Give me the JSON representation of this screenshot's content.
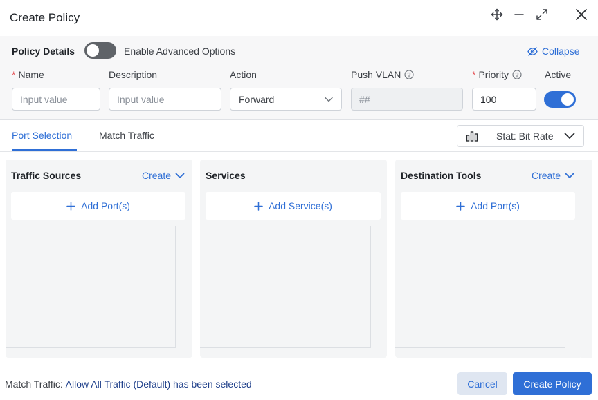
{
  "dialog": {
    "title": "Create Policy"
  },
  "details": {
    "section_label": "Policy Details",
    "advanced_label": "Enable Advanced Options",
    "advanced_enabled": false,
    "collapse_label": "Collapse",
    "fields": {
      "name": {
        "label": "Name",
        "required": "*",
        "placeholder": "Input value",
        "value": ""
      },
      "description": {
        "label": "Description",
        "placeholder": "Input value",
        "value": ""
      },
      "action": {
        "label": "Action",
        "value": "Forward"
      },
      "push_vlan": {
        "label": "Push VLAN",
        "placeholder": "##",
        "value": ""
      },
      "priority": {
        "label": "Priority",
        "required": "*",
        "value": "100"
      },
      "active": {
        "label": "Active",
        "value": true
      }
    }
  },
  "tabs": {
    "items": [
      {
        "label": "Port Selection",
        "active": true
      },
      {
        "label": "Match Traffic",
        "active": false
      }
    ],
    "stat_label": "Stat: Bit Rate"
  },
  "panels": [
    {
      "title": "Traffic Sources",
      "create_label": "Create",
      "add_label": "Add Port(s)"
    },
    {
      "title": "Services",
      "add_label": "Add Service(s)"
    },
    {
      "title": "Destination Tools",
      "create_label": "Create",
      "add_label": "Add Port(s)"
    }
  ],
  "footer": {
    "prefix": "Match Traffic:",
    "highlight": "Allow All Traffic (Default) has been selected",
    "cancel_label": "Cancel",
    "submit_label": "Create Policy"
  },
  "colors": {
    "accent": "#2f6fd6",
    "required": "#e5484d",
    "toggle_off": "#5f6368"
  },
  "icons": [
    "move-icon",
    "minimize-icon",
    "expand-icon",
    "close-icon",
    "eye-off-icon",
    "help-icon",
    "chevron-down-icon",
    "bar-chart-icon",
    "plus-icon"
  ]
}
